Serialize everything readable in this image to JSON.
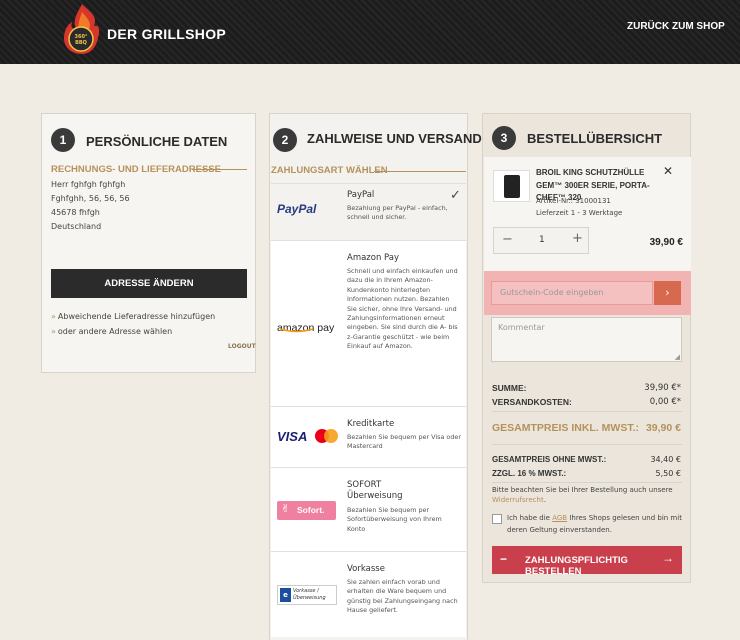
{
  "header": {
    "brand": "DER GRILLSHOP",
    "logo_text": "360° BBQ",
    "back_link": "ZURÜCK ZUM SHOP"
  },
  "personal": {
    "step": "1",
    "title": "PERSÖNLICHE DATEN",
    "subtitle": "RECHNUNGS- UND LIEFERADRESSE",
    "address": [
      "Herr fghfgh fghfgh",
      "Fghfghh, 56, 56, 56",
      "45678 fhfgh",
      "Deutschland"
    ],
    "change_button": "ADRESSE ÄNDERN",
    "link_delivery": "Abweichende Lieferadresse hinzufügen",
    "link_other": "oder andere Adresse wählen",
    "logout": "LOGOUT"
  },
  "payment": {
    "step": "2",
    "title": "ZAHLWEISE UND VERSAND",
    "subtitle": "ZAHLUNGSART WÄHLEN",
    "methods": [
      {
        "name": "PayPal",
        "desc": "Bezahlung per PayPal - einfach, schnell und sicher.",
        "logo": "PayPal",
        "selected": true
      },
      {
        "name": "Amazon Pay",
        "desc": "Schnell und einfach einkaufen und dazu die in Ihrem Amazon-Kundenkonto hinterlegten Informationen nutzen. Bezahlen Sie sicher, ohne Ihre Versand- und Zahlungsinformationen erneut eingeben. Sie sind durch die A- bis z-Garantie geschützt - wie beim Einkauf auf Amazon.",
        "logo": "amazon pay"
      },
      {
        "name": "Kreditkarte",
        "desc": "Bezahlen Sie bequem per Visa oder Mastercard",
        "logo": "VISA"
      },
      {
        "name": "SOFORT Überweisung",
        "desc": "Bezahlen Sie bequem per Sofortüberweisung von Ihrem Konto",
        "logo": "Sofort."
      },
      {
        "name": "Vorkasse",
        "desc": "Sie zahlen einfach vorab und erhalten die Ware bequem und günstig bei Zahlungseingang nach Hause geliefert.",
        "logo": "Vorkasse / Überweisung"
      }
    ]
  },
  "summary": {
    "step": "3",
    "title": "BESTELLÜBERSICHT",
    "product": {
      "name": "BROIL KING SCHUTZHÜLLE GEM™ 300ER SERIE, PORTA-CHEF™ 320",
      "article": "Artikel-Nr.: 31000131",
      "delivery": "Lieferzeit 1 - 3 Werktage",
      "qty": "1",
      "price": "39,90 €"
    },
    "voucher_placeholder": "Gutschein-Code eingeben",
    "comment_placeholder": "Kommentar",
    "rows": [
      {
        "label": "SUMME:",
        "value": "39,90 €*"
      },
      {
        "label": "VERSANDKOSTEN:",
        "value": "0,00 €*"
      }
    ],
    "total_label": "GESAMTPREIS INKL. MWST.:",
    "total_value": "39,90 €",
    "net_label": "GESAMTPREIS OHNE MWST.:",
    "net_value": "34,40 €",
    "vat_label": "ZZGL. 16 % MWST.:",
    "vat_value": "5,50 €",
    "note_prefix": "Bitte beachten Sie bei Ihrer Bestellung auch unsere ",
    "note_link": "Widerrufsrecht",
    "note_suffix": ".",
    "agb_prefix": "Ich habe die ",
    "agb_link": "AGB",
    "agb_suffix": " Ihres Shops gelesen und bin mit deren Geltung einverstanden.",
    "order_button": "ZAHLUNGSPFLICHTIG BESTELLEN"
  },
  "colors": {
    "accent_gold": "#b5925c",
    "order_red": "#c9404c",
    "voucher_highlight": "#f2b3b3"
  }
}
